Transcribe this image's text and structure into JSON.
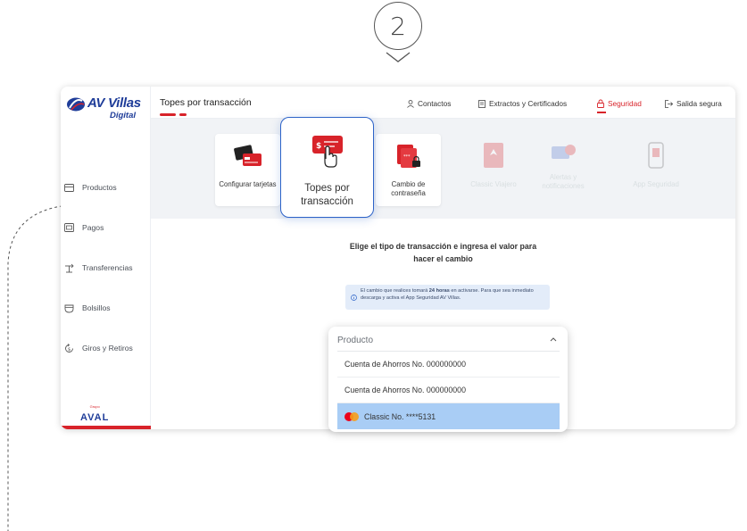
{
  "step": {
    "number": "2"
  },
  "sidebar": {
    "logo": {
      "brand": "AV Villas",
      "sub": "Digital"
    },
    "items": [
      {
        "label": "Productos",
        "icon": "wallet-icon"
      },
      {
        "label": "Pagos",
        "icon": "card-pay-icon"
      },
      {
        "label": "Transferencias",
        "icon": "transfer-icon"
      },
      {
        "label": "Bolsillos",
        "icon": "pocket-icon"
      },
      {
        "label": "Giros y Retiros",
        "icon": "withdraw-icon"
      }
    ],
    "footer": {
      "group": "Grupo",
      "name": "AVAL"
    }
  },
  "header": {
    "title": "Topes por transacción",
    "nav": [
      {
        "label": "Contactos",
        "icon": "user-icon"
      },
      {
        "label": "Extractos y Certificados",
        "icon": "document-icon"
      },
      {
        "label": "Seguridad",
        "icon": "lock-icon",
        "active": true
      },
      {
        "label": "Salida segura",
        "icon": "logout-icon"
      }
    ]
  },
  "cards": {
    "configurar": "Configurar tarjetas",
    "topes": "Topes por transacción",
    "cambio": "Cambio de contraseña",
    "classic": "Classic Viajero",
    "alertas": "Alertas y notificaciones",
    "app": "App Seguridad"
  },
  "main": {
    "instruction_line1": "Elige el tipo de transacción e ingresa el valor para",
    "instruction_line2": "hacer el cambio",
    "info": {
      "pre": "El cambio que realices tomará ",
      "bold": "24 horas",
      "post": " en activarse. Para que sea inmediato descarga y activa el App Seguridad AV Villas."
    }
  },
  "dropdown": {
    "label": "Producto",
    "options": [
      "Cuenta de Ahorros No. 000000000",
      "Cuenta de Ahorros No. 000000000",
      "Classic No. ****5131"
    ]
  },
  "colors": {
    "brand_blue": "#1f3d99",
    "brand_red": "#d8232a",
    "highlight_blue": "#2d63c8",
    "selected_row": "#a9cdf5"
  }
}
